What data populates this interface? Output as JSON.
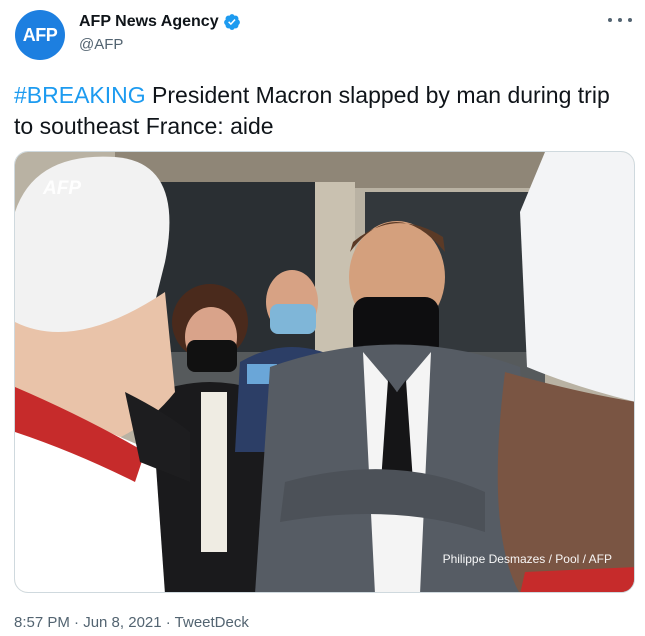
{
  "account": {
    "display_name": "AFP News Agency",
    "handle": "@AFP",
    "avatar_text": "AFP",
    "avatar_color": "#1d7fe0",
    "verified_icon": "verified-badge-icon"
  },
  "tweet": {
    "hashtag": "#BREAKING",
    "text": " President Macron slapped by man during trip to southeast France: aide",
    "hashtag_color": "#1d9bf0"
  },
  "media": {
    "watermark": "AFP",
    "image_id": "9BM2A6",
    "credit": "Philippe Desmazes / Pool / AFP"
  },
  "meta": {
    "timestamp": "8:57 PM · Jun 8, 2021 · TweetDeck"
  }
}
